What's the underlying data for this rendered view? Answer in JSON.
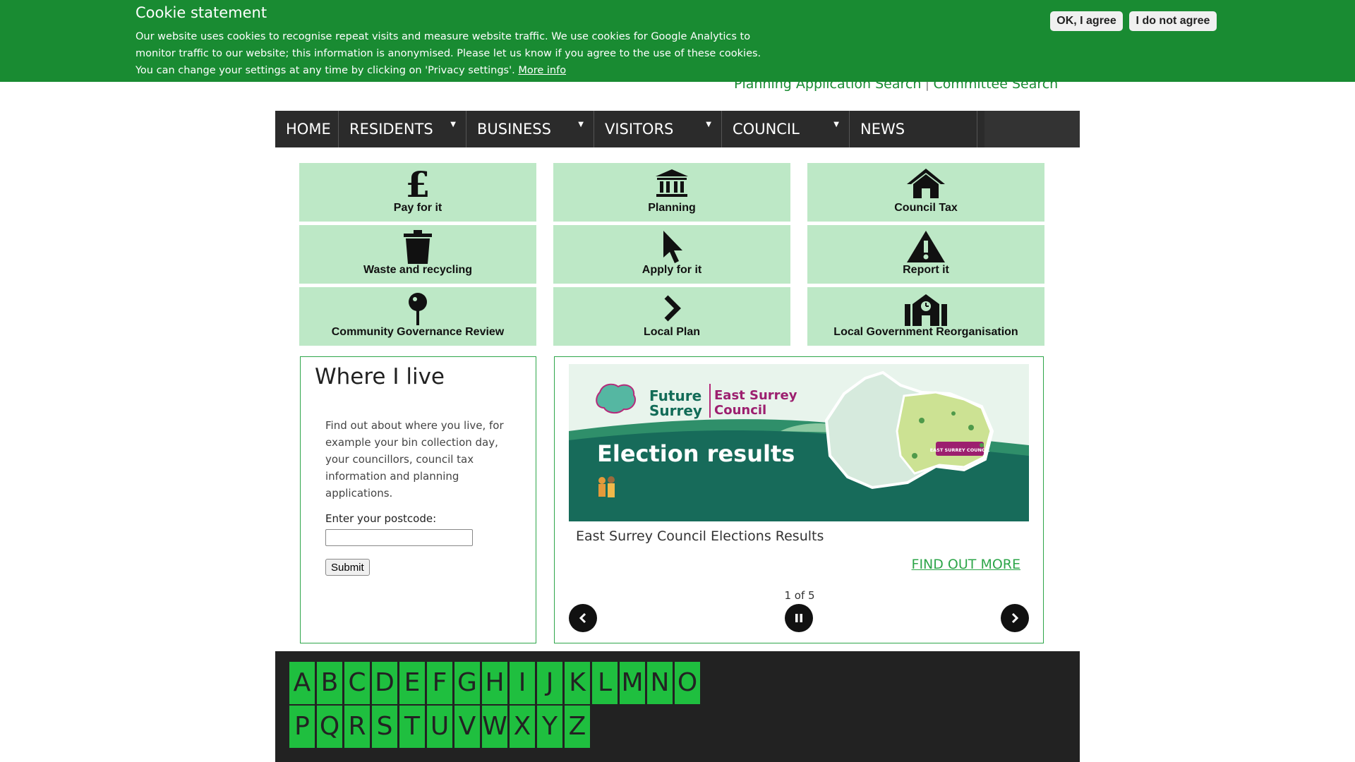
{
  "cookie": {
    "title": "Cookie statement",
    "text": "Our website uses cookies to recognise repeat visits and measure website traffic. We use cookies for Google Analytics to monitor traffic to our website; this information is anonymised. Please let us know if you agree to the use of these cookies. You can change your settings at any time by clicking on 'Privacy settings'.",
    "more_link": "More info",
    "agree": "OK, I agree",
    "disagree": "I do not agree"
  },
  "top_links": {
    "planning_search": "Planning Application Search",
    "separator": "|",
    "committee_search": "Committee Search"
  },
  "nav": {
    "items": [
      "HOME",
      "RESIDENTS",
      "BUSINESS",
      "VISITORS",
      "COUNCIL",
      "NEWS"
    ]
  },
  "tiles": [
    {
      "label": "Pay for it",
      "icon": "pound-icon"
    },
    {
      "label": "Planning",
      "icon": "bank-icon"
    },
    {
      "label": "Council Tax",
      "icon": "home-icon"
    },
    {
      "label": "Waste and recycling",
      "icon": "bin-icon"
    },
    {
      "label": "Apply for it",
      "icon": "cursor-icon"
    },
    {
      "label": "Report it",
      "icon": "warning-icon"
    },
    {
      "label": "Community Governance Review",
      "icon": "pin-icon"
    },
    {
      "label": "Local Plan",
      "icon": "chevron-right-icon"
    },
    {
      "label": "Local Government Reorganisation",
      "icon": "building-icon"
    }
  ],
  "where_i_live": {
    "title": "Where I live",
    "text": "Find out about where you live, for example your bin collection day, your councillors, council tax information and planning applications.",
    "postcode_label": "Enter your postcode:",
    "postcode_value": "",
    "submit": "Submit"
  },
  "carousel": {
    "banner_future": "Future",
    "banner_surrey": "Surrey",
    "banner_east": "East Surrey",
    "banner_council": "Council",
    "banner_headline": "Election results",
    "map_badge": "EAST SURREY COUNCIL",
    "caption": "East Surrey Council Elections Results",
    "find_out_more": "FIND OUT MORE",
    "counter": "1 of 5"
  },
  "az": [
    "A",
    "B",
    "C",
    "D",
    "E",
    "F",
    "G",
    "H",
    "I",
    "J",
    "K",
    "L",
    "M",
    "N",
    "O",
    "P",
    "Q",
    "R",
    "S",
    "T",
    "U",
    "V",
    "W",
    "X",
    "Y",
    "Z"
  ],
  "colors": {
    "brand_green": "#198b32",
    "tile_green": "#bde8c6",
    "letter_green": "#1fbf3f",
    "nav_dark": "#2b2b2b"
  }
}
